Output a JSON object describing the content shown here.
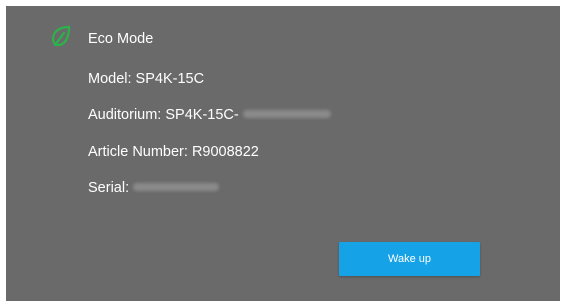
{
  "header": {
    "title": "Eco Mode",
    "icon": "eco-leaf-icon",
    "icon_color": "#2ab34a"
  },
  "details": {
    "model": "Model: SP4K-15C",
    "auditorium": "Auditorium: SP4K-15C-",
    "article": "Article Number: R9008822",
    "serial": "Serial:"
  },
  "actions": {
    "wake_label": "Wake up",
    "accent": "#16a2e6"
  },
  "colors": {
    "panel": "#6a6a6a",
    "text": "#ffffff"
  }
}
